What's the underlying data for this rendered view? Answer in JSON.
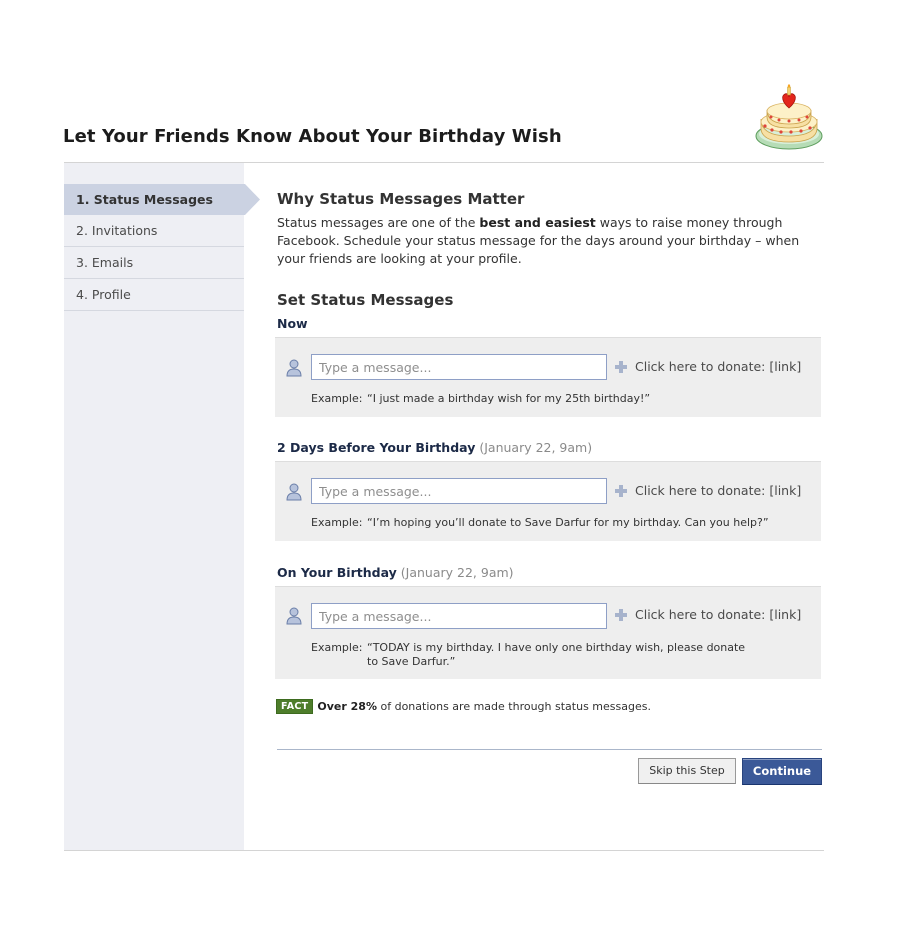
{
  "header": {
    "title": "Let Your Friends Know About Your Birthday Wish",
    "logo_icon": "birthday-cake-icon"
  },
  "sidebar": {
    "items": [
      {
        "label": "1. Status Messages",
        "active": true
      },
      {
        "label": "2. Invitations",
        "active": false
      },
      {
        "label": "3. Emails",
        "active": false
      },
      {
        "label": "4. Profile",
        "active": false
      }
    ]
  },
  "main": {
    "heading": "Why Status Messages Matter",
    "intro_before": "Status messages are one of the ",
    "intro_bold": "best and easiest",
    "intro_after": " ways to raise money through Facebook. Schedule your status message for the days around your birthday – when your friends are looking at your profile.",
    "set_heading": "Set Status Messages",
    "sections": [
      {
        "label": "Now",
        "date": "",
        "placeholder": "Type a message...",
        "donate_text": "Click here to donate: [link]",
        "example_label": "Example:",
        "example_text": "“I just made a birthday wish for my 25th birthday!”"
      },
      {
        "label": "2 Days Before Your Birthday",
        "date": "(January 22, 9am)",
        "placeholder": "Type a message...",
        "donate_text": "Click here to donate: [link]",
        "example_label": "Example:",
        "example_text": "“I’m hoping you’ll donate to Save Darfur for my birthday. Can you help?”"
      },
      {
        "label": "On Your Birthday",
        "date": "(January 22, 9am)",
        "placeholder": "Type a message...",
        "donate_text": "Click here to donate: [link]",
        "example_label": "Example:",
        "example_text": "“TODAY is my birthday. I have only one birthday wish, please donate to Save Darfur.”"
      }
    ],
    "fact": {
      "badge": "FACT",
      "bold": "Over 28%",
      "text": " of donations are made through status messages."
    }
  },
  "actions": {
    "skip_label": "Skip this Step",
    "continue_label": "Continue"
  },
  "colors": {
    "accent": "#3b5998",
    "sidebar_bg": "#eeeff4",
    "fact_badge": "#4e7d2b"
  }
}
